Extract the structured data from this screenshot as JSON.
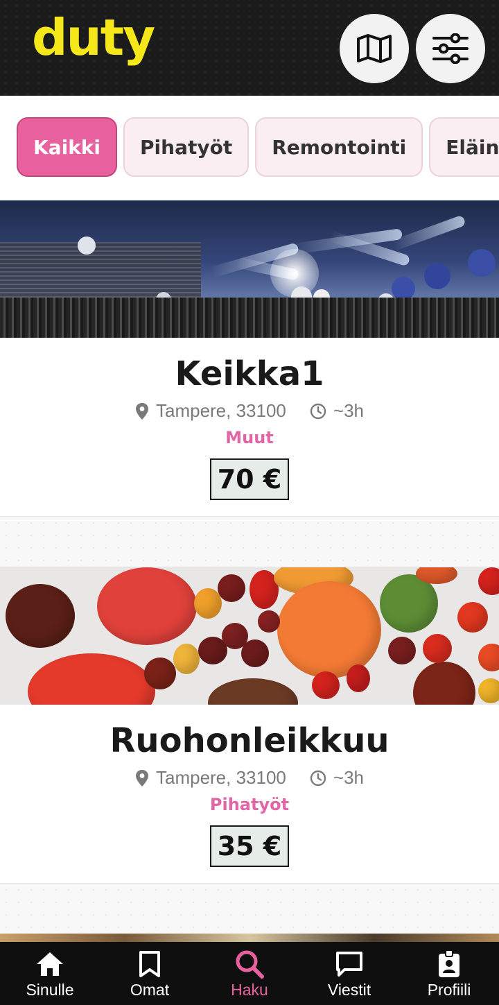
{
  "header": {
    "logo": "duty",
    "map_button_icon": "map-icon",
    "filter_button_icon": "sliders-icon"
  },
  "colors": {
    "brand_yellow": "#f5e71a",
    "accent_pink": "#e9609f",
    "header_bg": "#1b1b1b"
  },
  "categories": {
    "items": [
      {
        "label": "Kaikki",
        "active": true
      },
      {
        "label": "Pihatyöt",
        "active": false
      },
      {
        "label": "Remontointi",
        "active": false
      },
      {
        "label": "Eläintenhoito",
        "active": false
      }
    ]
  },
  "jobs": [
    {
      "title": "Keikka1",
      "location": "Tampere, 33100",
      "duration": "~3h",
      "category": "Muut",
      "price": "70 €",
      "image_icon": "concert-image"
    },
    {
      "title": "Ruohonleikkuu",
      "location": "Tampere, 33100",
      "duration": "~3h",
      "category": "Pihatyöt",
      "price": "35 €",
      "image_icon": "tomatoes-image"
    }
  ],
  "nav": {
    "items": [
      {
        "label": "Sinulle",
        "icon": "home-icon",
        "active": false
      },
      {
        "label": "Omat",
        "icon": "bookmark-icon",
        "active": false
      },
      {
        "label": "Haku",
        "icon": "search-icon",
        "active": true
      },
      {
        "label": "Viestit",
        "icon": "chat-icon",
        "active": false
      },
      {
        "label": "Profiili",
        "icon": "badge-icon",
        "active": false
      }
    ]
  }
}
